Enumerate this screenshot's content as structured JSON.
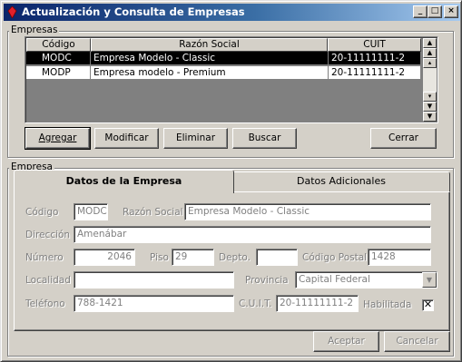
{
  "window": {
    "title": "Actualización y Consulta de Empresas"
  },
  "empresas_group": {
    "label": "Empresas",
    "columns": [
      "Código",
      "Razón Social",
      "CUIT"
    ],
    "rows": [
      {
        "codigo": "MODC",
        "razon": "Empresa Modelo - Classic",
        "cuit": "20-11111111-2",
        "selected": true
      },
      {
        "codigo": "MODP",
        "razon": "Empresa modelo - Premium",
        "cuit": "20-11111111-2",
        "selected": false
      }
    ]
  },
  "buttons": {
    "agregar": "Agregar",
    "modificar": "Modificar",
    "eliminar": "Eliminar",
    "buscar": "Buscar",
    "cerrar": "Cerrar",
    "aceptar": "Aceptar",
    "cancelar": "Cancelar"
  },
  "empresa_group": {
    "label": "Empresa"
  },
  "tabs": {
    "datos_empresa": "Datos de la Empresa",
    "datos_adicionales": "Datos Adicionales"
  },
  "form": {
    "codigo_label": "Código",
    "codigo": "MODC",
    "razon_label": "Razón Social",
    "razon": "Empresa Modelo - Classic",
    "direccion_label": "Dirección",
    "direccion": "Amenábar",
    "numero_label": "Número",
    "numero": "2046",
    "piso_label": "Piso",
    "piso": "29",
    "depto_label": "Depto.",
    "depto": "",
    "cp_label": "Código Postal",
    "cp": "1428",
    "localidad_label": "Localidad",
    "localidad": "",
    "provincia_label": "Provincia",
    "provincia": "Capital Federal",
    "telefono_label": "Teléfono",
    "telefono": "788-1421",
    "cuit_label": "C.U.I.T.",
    "cuit": "20-11111111-2",
    "habilitada_label": "Habilitada",
    "habilitada": true
  }
}
